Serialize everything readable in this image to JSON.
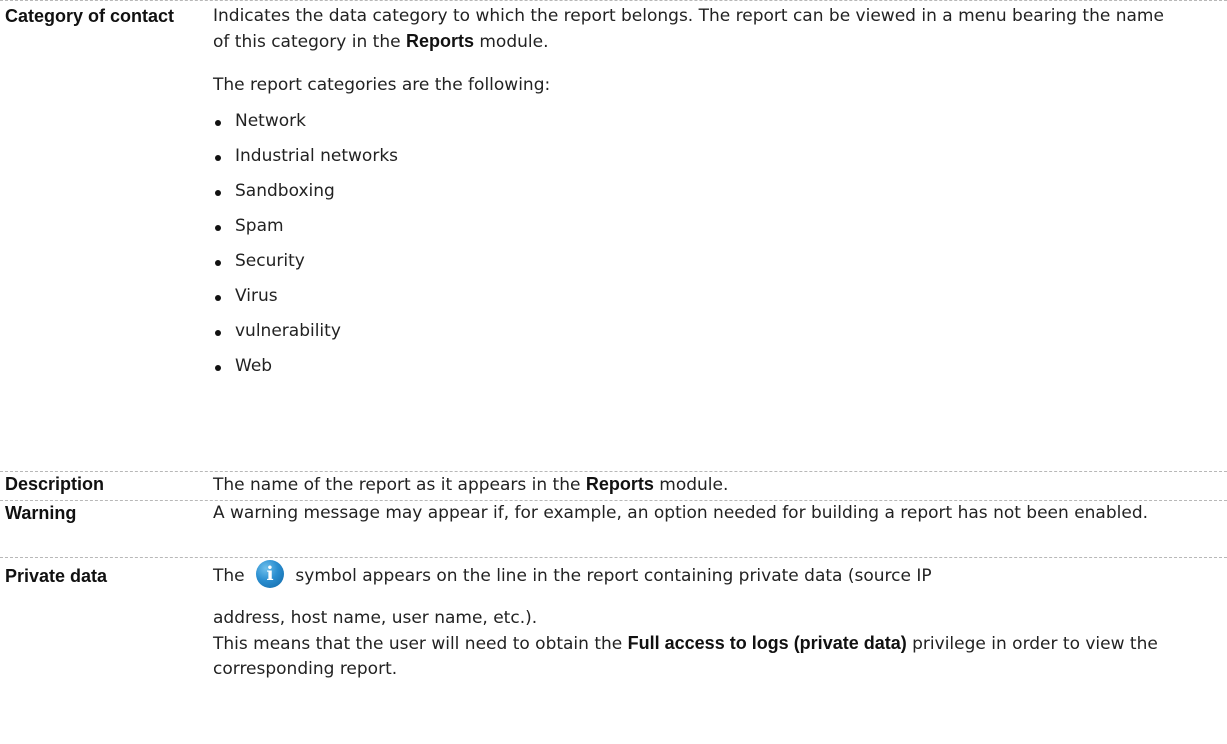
{
  "rows": [
    {
      "term": "Category of contact",
      "intro_before": "Indicates the data category to which the report belongs. The report can be viewed in a menu bearing the name of this category in the ",
      "intro_bold": "Reports",
      "intro_after": " module.",
      "list_intro": "The report categories are the following:",
      "categories": [
        "Network",
        "Industrial networks",
        "Sandboxing",
        "Spam",
        "Security",
        "Virus",
        "vulnerability",
        "Web"
      ]
    },
    {
      "term": "Description",
      "text_before": "The name of the report as it appears in the ",
      "text_bold": "Reports",
      "text_after": " module."
    },
    {
      "term": "Warning",
      "text": "A warning message may appear if, for example, an option needed for building a report has not been enabled."
    },
    {
      "term": "Private data",
      "line1_before": "The ",
      "icon": "info-icon",
      "line1_after": " symbol appears on the line in the report containing private data (source IP",
      "line2": "address, host name, user name, etc.).",
      "line3_before": "This means that the user will need to obtain the ",
      "line3_bold": "Full access to logs (private data)",
      "line3_after": " privilege in order to view the corresponding report."
    }
  ]
}
